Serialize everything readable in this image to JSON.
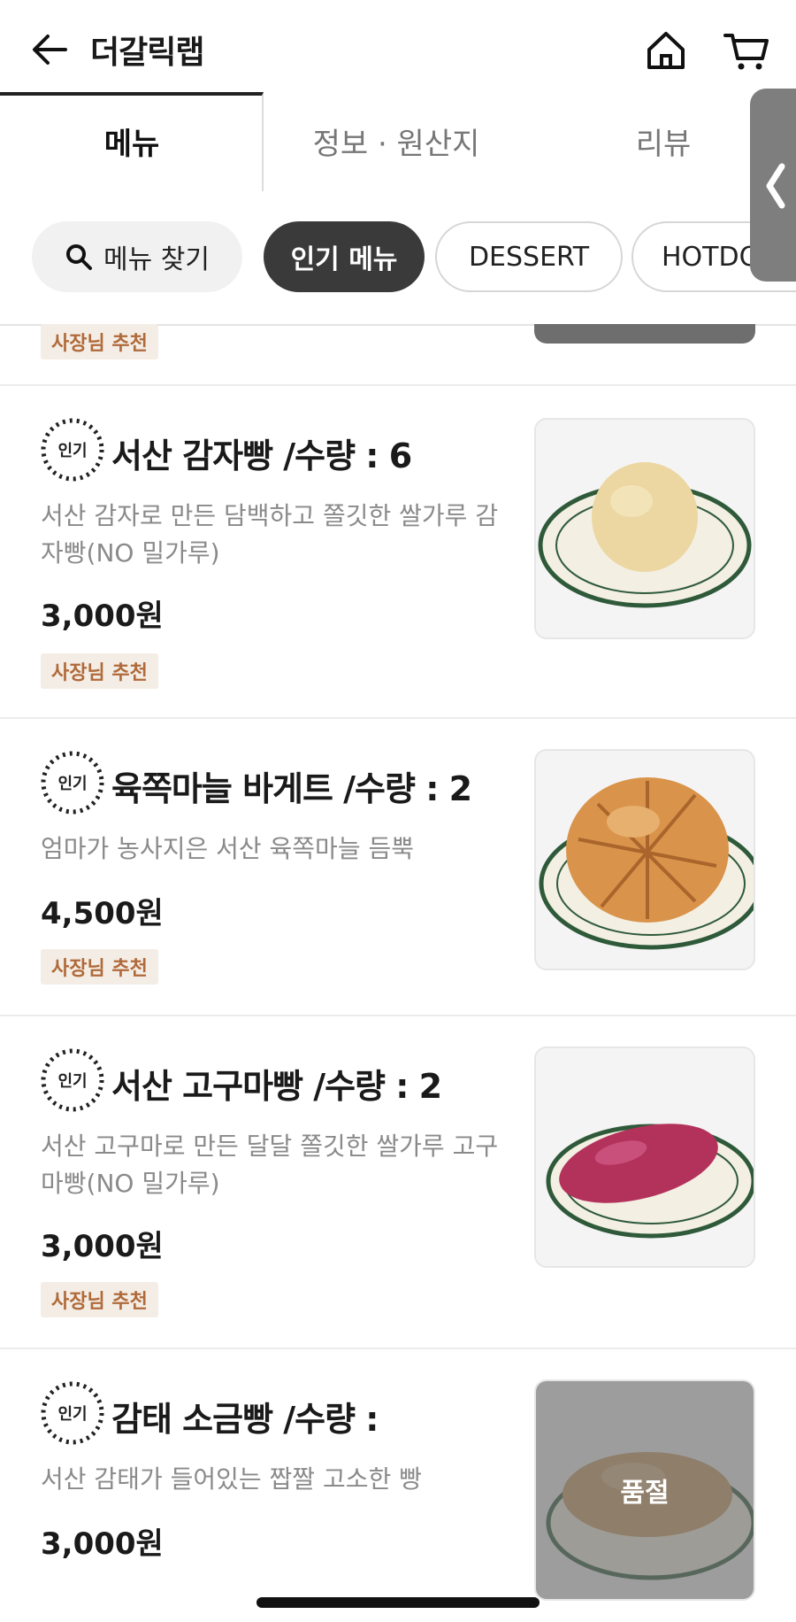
{
  "header": {
    "title": "더갈릭랩"
  },
  "tabs": [
    {
      "label": "메뉴"
    },
    {
      "label": "정보 · 원산지"
    },
    {
      "label": "리뷰"
    }
  ],
  "chips": {
    "search": "메뉴 찾기",
    "popular": "인기 메뉴",
    "dessert": "DESSERT",
    "hotdog": "HOTDOG"
  },
  "partial_item": {
    "badge": "사장님 추천"
  },
  "popular_icon_text": "인기",
  "items": [
    {
      "name": "서산 감자빵 /수량 : 6",
      "desc": "서산 감자로 만든 담백하고 쫄깃한 쌀가루 감자빵(NO 밀가루)",
      "price": "3,000원",
      "badge": "사장님 추천",
      "image": "potato-bread",
      "color": "#ecd7a2"
    },
    {
      "name": "육쪽마늘 바게트 /수량 : 2",
      "desc": "엄마가 농사지은 서산 육쪽마늘 듬뿍",
      "price": "4,500원",
      "badge": "사장님 추천",
      "image": "garlic-bread",
      "color": "#d9934a"
    },
    {
      "name": "서산 고구마빵 /수량 : 2",
      "desc": "서산 고구마로 만든 달달 쫄깃한 쌀가루 고구마빵(NO 밀가루)",
      "price": "3,000원",
      "badge": "사장님 추천",
      "image": "sweet-potato-bread",
      "color": "#b3325c"
    },
    {
      "name": "감태 소금빵 /수량 :",
      "desc": "서산 감태가 들어있는 짭짤 고소한 빵",
      "price": "3,000원",
      "soldout": "품절",
      "image": "salt-bread",
      "color": "#c99a63"
    }
  ]
}
